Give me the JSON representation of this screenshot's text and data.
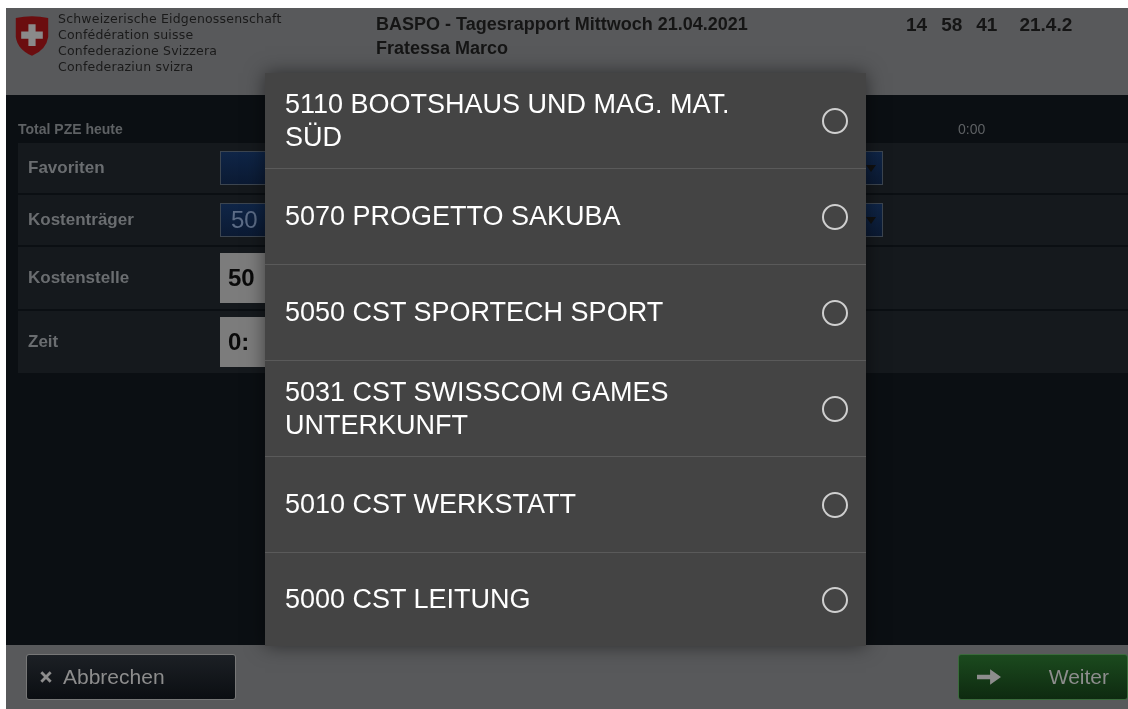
{
  "header": {
    "confederation_lines": [
      "Schweizerische Eidgenossenschaft",
      "Confédération suisse",
      "Confederazione Svizzera",
      "Confederaziun svizra"
    ],
    "title": "BASPO - Tagesrapport Mittwoch 21.04.2021",
    "user": "Fratessa Marco",
    "clock": [
      "14",
      "58",
      "41"
    ],
    "date": "21.4.2"
  },
  "summary": {
    "label": "Total PZE heute",
    "value": "0:00"
  },
  "form_rows": [
    {
      "label": "Favoriten",
      "kind": "dropdown",
      "value": ""
    },
    {
      "label": "Kostenträger",
      "kind": "dropdown",
      "value": "50"
    },
    {
      "label": "Kostenstelle",
      "kind": "input",
      "value": "50"
    },
    {
      "label": "Zeit",
      "kind": "input",
      "value": "0:"
    }
  ],
  "dialog": {
    "options": [
      {
        "label": "5110 BOOTSHAUS UND MAG. MAT. SÜD",
        "selected": false
      },
      {
        "label": "5070 PROGETTO SAKUBA",
        "selected": false
      },
      {
        "label": "5050 CST SPORTECH SPORT",
        "selected": false
      },
      {
        "label": "5031 CST SWISSCOM GAMES UNTERKUNFT",
        "selected": false
      },
      {
        "label": "5010 CST WERKSTATT",
        "selected": false
      },
      {
        "label": "5000 CST LEITUNG",
        "selected": false
      }
    ]
  },
  "footer": {
    "cancel": "Abbrechen",
    "next": "Weiter"
  }
}
